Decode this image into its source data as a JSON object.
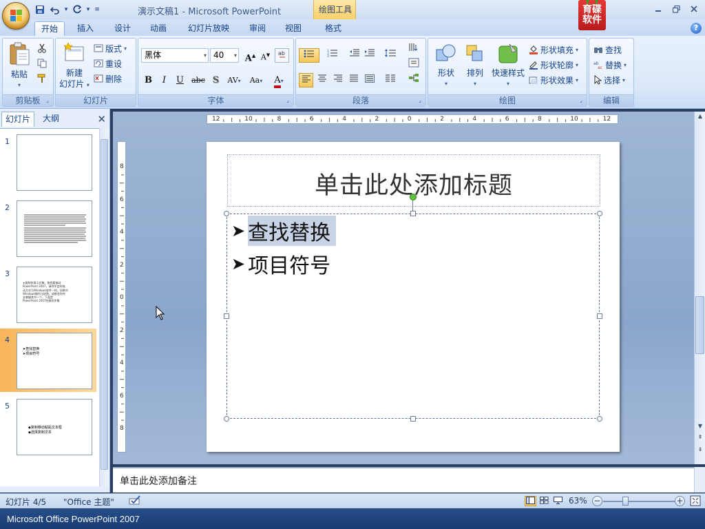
{
  "window": {
    "title": "演示文稿1 - Microsoft PowerPoint",
    "context_tab_group": "绘图工具",
    "controls": [
      "–",
      "❐",
      "✕"
    ]
  },
  "qat": {
    "save": "💾",
    "undo": "↶",
    "redo": "↻"
  },
  "brand": {
    "line1": "育碟",
    "line2": "软件"
  },
  "tabs": [
    {
      "label": "开始",
      "active": true
    },
    {
      "label": "插入"
    },
    {
      "label": "设计"
    },
    {
      "label": "动画"
    },
    {
      "label": "幻灯片放映"
    },
    {
      "label": "审阅"
    },
    {
      "label": "视图"
    },
    {
      "label": "格式"
    }
  ],
  "ribbon": {
    "clipboard": {
      "label": "剪贴板",
      "paste": "粘贴"
    },
    "slides": {
      "label": "幻灯片",
      "new_slide_1": "新建",
      "new_slide_2": "幻灯片",
      "layout": "版式",
      "reset": "重设",
      "delete": "删除"
    },
    "font": {
      "label": "字体",
      "name": "黑体",
      "size": "40",
      "bold": "B",
      "italic": "I",
      "underline": "U",
      "strike": "abc",
      "shadow": "S",
      "spacing": "AV",
      "case": "Aa",
      "color": "A",
      "grow": "A",
      "shrink": "A"
    },
    "paragraph": {
      "label": "段落"
    },
    "drawing": {
      "label": "绘图",
      "shapes": "形状",
      "arrange": "排列",
      "quick_styles": "快速样式",
      "fill": "形状填充",
      "outline": "形状轮廓",
      "effects": "形状效果"
    },
    "editing": {
      "label": "编辑",
      "find": "查找",
      "replace": "替换",
      "select": "选择"
    }
  },
  "left_pane": {
    "tab_slides": "幻灯片",
    "tab_outline": "大纲",
    "thumbnails": [
      {
        "num": "1",
        "kind": "blank"
      },
      {
        "num": "2",
        "kind": "dense"
      },
      {
        "num": "3",
        "kind": "text",
        "lines": [
          "➤复制你演示文稿，查找要抽动",
          "PowerPoint 2007，请你学会的抽",
          "动方式与Windows软件一样，如果对",
          "Windows操作比较熟，成都会你完",
          "全掌握其中一个，下面是",
          "PowerPoint 2007的操作步骤"
        ]
      },
      {
        "num": "4",
        "kind": "bullets",
        "lines": [
          "➤查找替换",
          "➤项目符号"
        ],
        "selected": true
      },
      {
        "num": "5",
        "kind": "bullets",
        "lines": [
          "◆复制移动粘贴文本框",
          "◆选择复制文本"
        ]
      }
    ]
  },
  "rulers": {
    "h_labels": [
      "12",
      "10",
      "8",
      "6",
      "4",
      "2",
      "0",
      "2",
      "4",
      "6",
      "8",
      "10",
      "12"
    ],
    "v_labels": [
      "8",
      "6",
      "4",
      "2",
      "0",
      "2",
      "4",
      "6",
      "8"
    ]
  },
  "slide": {
    "title_placeholder": "单击此处添加标题",
    "bullets": [
      "查找替换",
      "项目符号"
    ]
  },
  "notes": {
    "placeholder": "单击此处添加备注"
  },
  "status": {
    "slide_info": "幻灯片 4/5",
    "theme": "\"Office 主题\"",
    "zoom": "63%"
  },
  "taskbar": {
    "text": "Microsoft Office PowerPoint 2007"
  },
  "colors": {
    "accent": "#15428b",
    "ribbon": "#dbe8f9",
    "selection": "#f8b458",
    "workarea": "#8ba6cc"
  }
}
